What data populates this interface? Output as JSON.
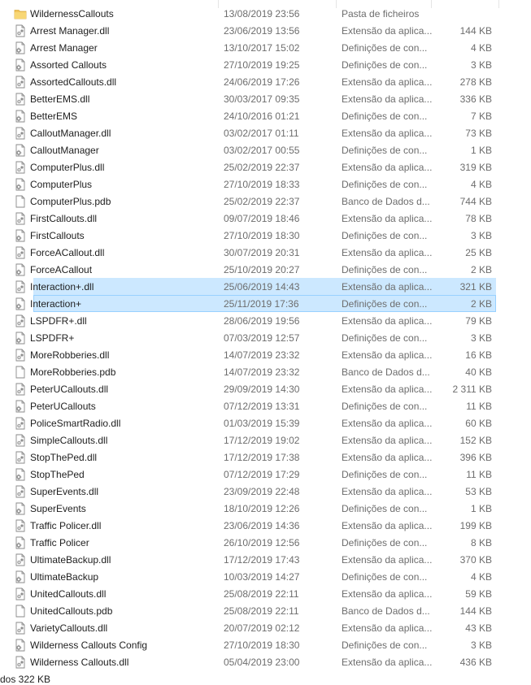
{
  "files": [
    {
      "name": "WildernessCallouts",
      "modified": "13/08/2019 23:56",
      "type": "Pasta de ficheiros",
      "size": "",
      "icon": "folder"
    },
    {
      "name": "Arrest Manager.dll",
      "modified": "23/06/2019 13:56",
      "type": "Extensão da aplica...",
      "size": "144 KB",
      "icon": "dll"
    },
    {
      "name": "Arrest Manager",
      "modified": "13/10/2017 15:02",
      "type": "Definições de con...",
      "size": "4 KB",
      "icon": "config"
    },
    {
      "name": "Assorted Callouts",
      "modified": "27/10/2019 19:25",
      "type": "Definições de con...",
      "size": "3 KB",
      "icon": "config"
    },
    {
      "name": "AssortedCallouts.dll",
      "modified": "24/06/2019 17:26",
      "type": "Extensão da aplica...",
      "size": "278 KB",
      "icon": "dll"
    },
    {
      "name": "BetterEMS.dll",
      "modified": "30/03/2017 09:35",
      "type": "Extensão da aplica...",
      "size": "336 KB",
      "icon": "dll"
    },
    {
      "name": "BetterEMS",
      "modified": "24/10/2016 01:21",
      "type": "Definições de con...",
      "size": "7 KB",
      "icon": "config"
    },
    {
      "name": "CalloutManager.dll",
      "modified": "03/02/2017 01:11",
      "type": "Extensão da aplica...",
      "size": "73 KB",
      "icon": "dll"
    },
    {
      "name": "CalloutManager",
      "modified": "03/02/2017 00:55",
      "type": "Definições de con...",
      "size": "1 KB",
      "icon": "config"
    },
    {
      "name": "ComputerPlus.dll",
      "modified": "25/02/2019 22:37",
      "type": "Extensão da aplica...",
      "size": "319 KB",
      "icon": "dll"
    },
    {
      "name": "ComputerPlus",
      "modified": "27/10/2019 18:33",
      "type": "Definições de con...",
      "size": "4 KB",
      "icon": "config"
    },
    {
      "name": "ComputerPlus.pdb",
      "modified": "25/02/2019 22:37",
      "type": "Banco de Dados d...",
      "size": "744 KB",
      "icon": "file"
    },
    {
      "name": "FirstCallouts.dll",
      "modified": "09/07/2019 18:46",
      "type": "Extensão da aplica...",
      "size": "78 KB",
      "icon": "dll"
    },
    {
      "name": "FirstCallouts",
      "modified": "27/10/2019 18:30",
      "type": "Definições de con...",
      "size": "3 KB",
      "icon": "config"
    },
    {
      "name": "ForceACallout.dll",
      "modified": "30/07/2019 20:31",
      "type": "Extensão da aplica...",
      "size": "25 KB",
      "icon": "dll"
    },
    {
      "name": "ForceACallout",
      "modified": "25/10/2019 20:27",
      "type": "Definições de con...",
      "size": "2 KB",
      "icon": "config"
    },
    {
      "name": "Interaction+.dll",
      "modified": "25/06/2019 14:43",
      "type": "Extensão da aplica...",
      "size": "321 KB",
      "icon": "dll",
      "selected": "sel1"
    },
    {
      "name": "Interaction+",
      "modified": "25/11/2019 17:36",
      "type": "Definições de con...",
      "size": "2 KB",
      "icon": "config",
      "selected": "sel2"
    },
    {
      "name": "LSPDFR+.dll",
      "modified": "28/06/2019 19:56",
      "type": "Extensão da aplica...",
      "size": "79 KB",
      "icon": "dll"
    },
    {
      "name": "LSPDFR+",
      "modified": "07/03/2019 12:57",
      "type": "Definições de con...",
      "size": "3 KB",
      "icon": "config"
    },
    {
      "name": "MoreRobberies.dll",
      "modified": "14/07/2019 23:32",
      "type": "Extensão da aplica...",
      "size": "16 KB",
      "icon": "dll"
    },
    {
      "name": "MoreRobberies.pdb",
      "modified": "14/07/2019 23:32",
      "type": "Banco de Dados d...",
      "size": "40 KB",
      "icon": "file"
    },
    {
      "name": "PeterUCallouts.dll",
      "modified": "29/09/2019 14:30",
      "type": "Extensão da aplica...",
      "size": "2 311 KB",
      "icon": "dll"
    },
    {
      "name": "PeterUCallouts",
      "modified": "07/12/2019 13:31",
      "type": "Definições de con...",
      "size": "11 KB",
      "icon": "config"
    },
    {
      "name": "PoliceSmartRadio.dll",
      "modified": "01/03/2019 15:39",
      "type": "Extensão da aplica...",
      "size": "60 KB",
      "icon": "dll"
    },
    {
      "name": "SimpleCallouts.dll",
      "modified": "17/12/2019 19:02",
      "type": "Extensão da aplica...",
      "size": "152 KB",
      "icon": "dll"
    },
    {
      "name": "StopThePed.dll",
      "modified": "17/12/2019 17:38",
      "type": "Extensão da aplica...",
      "size": "396 KB",
      "icon": "dll"
    },
    {
      "name": "StopThePed",
      "modified": "07/12/2019 17:29",
      "type": "Definições de con...",
      "size": "11 KB",
      "icon": "config"
    },
    {
      "name": "SuperEvents.dll",
      "modified": "23/09/2019 22:48",
      "type": "Extensão da aplica...",
      "size": "53 KB",
      "icon": "dll"
    },
    {
      "name": "SuperEvents",
      "modified": "18/10/2019 12:26",
      "type": "Definições de con...",
      "size": "1 KB",
      "icon": "config"
    },
    {
      "name": "Traffic Policer.dll",
      "modified": "23/06/2019 14:36",
      "type": "Extensão da aplica...",
      "size": "199 KB",
      "icon": "dll"
    },
    {
      "name": "Traffic Policer",
      "modified": "26/10/2019 12:56",
      "type": "Definições de con...",
      "size": "8 KB",
      "icon": "config"
    },
    {
      "name": "UltimateBackup.dll",
      "modified": "17/12/2019 17:43",
      "type": "Extensão da aplica...",
      "size": "370 KB",
      "icon": "dll"
    },
    {
      "name": "UltimateBackup",
      "modified": "10/03/2019 14:27",
      "type": "Definições de con...",
      "size": "4 KB",
      "icon": "config"
    },
    {
      "name": "UnitedCallouts.dll",
      "modified": "25/08/2019 22:11",
      "type": "Extensão da aplica...",
      "size": "59 KB",
      "icon": "dll"
    },
    {
      "name": "UnitedCallouts.pdb",
      "modified": "25/08/2019 22:11",
      "type": "Banco de Dados d...",
      "size": "144 KB",
      "icon": "file"
    },
    {
      "name": "VarietyCallouts.dll",
      "modified": "20/07/2019 02:12",
      "type": "Extensão da aplica...",
      "size": "43 KB",
      "icon": "dll"
    },
    {
      "name": "Wilderness Callouts Config",
      "modified": "27/10/2019 18:30",
      "type": "Definições de con...",
      "size": "3 KB",
      "icon": "config"
    },
    {
      "name": "Wilderness Callouts.dll",
      "modified": "05/04/2019 23:00",
      "type": "Extensão da aplica...",
      "size": "436 KB",
      "icon": "dll"
    }
  ],
  "status_bar": {
    "text": "dos 322 KB"
  },
  "colors": {
    "folder": "#f2c55c",
    "selection": "#cce8ff",
    "selection_border": "#99d1ff"
  }
}
